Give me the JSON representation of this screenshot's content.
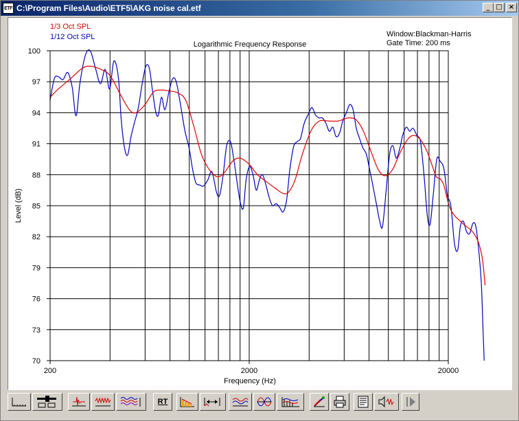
{
  "window": {
    "title": "C:\\Program Files\\Audio\\ETF5\\AKG noise cal.etf",
    "icon_text": "ETF",
    "controls": {
      "minimize": "_",
      "maximize": "□",
      "close": "×"
    }
  },
  "plot": {
    "header_left": [
      "1/3 Oct SPL",
      "1/12 Oct SPL"
    ],
    "header_right": [
      "Window:Blackman-Harris",
      "Gate Time: 200 ms"
    ]
  },
  "chart_data": {
    "type": "line",
    "title": "Logarithmic Frequency Response",
    "xlabel": "Frequency (Hz)",
    "ylabel": "Level (dB)",
    "xscale": "log",
    "xlim": [
      200,
      20000
    ],
    "ylim": [
      70,
      100
    ],
    "xticks": [
      200,
      2000,
      20000
    ],
    "yticks": [
      70,
      73,
      76,
      79,
      82,
      85,
      88,
      91,
      94,
      97,
      100
    ],
    "grid": true,
    "legend": "top-left",
    "series": [
      {
        "name": "1/3 Oct SPL",
        "color": "#e00000",
        "points": [
          [
            200,
            95.5
          ],
          [
            220,
            96.3
          ],
          [
            250,
            97.2
          ],
          [
            290,
            98.3
          ],
          [
            320,
            98.5
          ],
          [
            360,
            98.2
          ],
          [
            400,
            97.6
          ],
          [
            450,
            95.8
          ],
          [
            500,
            94.3
          ],
          [
            540,
            94.0
          ],
          [
            600,
            94.8
          ],
          [
            660,
            96.0
          ],
          [
            720,
            96.2
          ],
          [
            800,
            96.1
          ],
          [
            880,
            95.9
          ],
          [
            960,
            95.2
          ],
          [
            1050,
            92.8
          ],
          [
            1150,
            90.0
          ],
          [
            1250,
            88.6
          ],
          [
            1380,
            87.8
          ],
          [
            1500,
            88.2
          ],
          [
            1650,
            89.3
          ],
          [
            1800,
            89.6
          ],
          [
            2000,
            89.0
          ],
          [
            2200,
            88.0
          ],
          [
            2450,
            87.3
          ],
          [
            2700,
            86.7
          ],
          [
            2950,
            86.2
          ],
          [
            3150,
            86.3
          ],
          [
            3400,
            87.5
          ],
          [
            3700,
            90.0
          ],
          [
            4100,
            92.3
          ],
          [
            4500,
            93.2
          ],
          [
            5000,
            93.2
          ],
          [
            5600,
            93.2
          ],
          [
            6300,
            93.5
          ],
          [
            6900,
            93.3
          ],
          [
            7500,
            92.2
          ],
          [
            8200,
            90.2
          ],
          [
            8900,
            88.5
          ],
          [
            9600,
            87.9
          ],
          [
            10500,
            88.5
          ],
          [
            11500,
            90.2
          ],
          [
            12600,
            91.5
          ],
          [
            13500,
            91.8
          ],
          [
            14500,
            91.4
          ],
          [
            15600,
            90.3
          ],
          [
            16600,
            88.9
          ],
          [
            17400,
            87.8
          ],
          [
            18200,
            87.6
          ],
          [
            19000,
            87.0
          ],
          [
            19800,
            85.6
          ],
          [
            20600,
            84.6
          ],
          [
            21600,
            84.0
          ],
          [
            22700,
            83.6
          ],
          [
            23900,
            83.2
          ],
          [
            25400,
            82.8
          ],
          [
            26900,
            82.3
          ],
          [
            28400,
            81.4
          ],
          [
            29700,
            79.8
          ],
          [
            30600,
            77.3
          ]
        ]
      },
      {
        "name": "1/12 Oct SPL",
        "color": "#0000c0",
        "points": [
          [
            200,
            95.2
          ],
          [
            210,
            97.3
          ],
          [
            220,
            97.5
          ],
          [
            232,
            97.2
          ],
          [
            245,
            97.9
          ],
          [
            258,
            96.5
          ],
          [
            270,
            93.7
          ],
          [
            282,
            96.8
          ],
          [
            300,
            99.5
          ],
          [
            318,
            100.0
          ],
          [
            338,
            98.3
          ],
          [
            358,
            96.8
          ],
          [
            378,
            98.2
          ],
          [
            398,
            96.3
          ],
          [
            418,
            99.0
          ],
          [
            440,
            97.5
          ],
          [
            455,
            93.4
          ],
          [
            472,
            90.7
          ],
          [
            490,
            89.9
          ],
          [
            510,
            91.7
          ],
          [
            530,
            93.0
          ],
          [
            555,
            94.5
          ],
          [
            580,
            96.8
          ],
          [
            605,
            98.5
          ],
          [
            630,
            98.3
          ],
          [
            655,
            96.0
          ],
          [
            680,
            94.0
          ],
          [
            700,
            93.8
          ],
          [
            725,
            95.5
          ],
          [
            755,
            94.3
          ],
          [
            790,
            96.0
          ],
          [
            825,
            97.3
          ],
          [
            860,
            97.0
          ],
          [
            900,
            95.0
          ],
          [
            950,
            92.3
          ],
          [
            1000,
            90.5
          ],
          [
            1040,
            88.5
          ],
          [
            1080,
            87.2
          ],
          [
            1130,
            87.0
          ],
          [
            1180,
            86.9
          ],
          [
            1240,
            87.5
          ],
          [
            1300,
            88.3
          ],
          [
            1370,
            86.3
          ],
          [
            1420,
            86.0
          ],
          [
            1480,
            88.0
          ],
          [
            1540,
            90.8
          ],
          [
            1610,
            91.2
          ],
          [
            1680,
            89.3
          ],
          [
            1740,
            87.2
          ],
          [
            1810,
            85.2
          ],
          [
            1870,
            84.8
          ],
          [
            1930,
            87.5
          ],
          [
            2010,
            88.8
          ],
          [
            2090,
            88.0
          ],
          [
            2170,
            86.5
          ],
          [
            2250,
            87.5
          ],
          [
            2330,
            88.0
          ],
          [
            2420,
            87.1
          ],
          [
            2520,
            85.8
          ],
          [
            2620,
            85.0
          ],
          [
            2730,
            85.2
          ],
          [
            2850,
            84.8
          ],
          [
            2960,
            84.4
          ],
          [
            3080,
            85.5
          ],
          [
            3200,
            88.5
          ],
          [
            3340,
            90.7
          ],
          [
            3480,
            91.2
          ],
          [
            3620,
            91.5
          ],
          [
            3780,
            93.0
          ],
          [
            3950,
            93.8
          ],
          [
            4130,
            94.5
          ],
          [
            4300,
            93.8
          ],
          [
            4480,
            93.5
          ],
          [
            4660,
            93.5
          ],
          [
            4850,
            93.0
          ],
          [
            5050,
            92.2
          ],
          [
            5260,
            92.6
          ],
          [
            5460,
            91.7
          ],
          [
            5680,
            92.0
          ],
          [
            5900,
            93.2
          ],
          [
            6150,
            94.0
          ],
          [
            6400,
            94.8
          ],
          [
            6650,
            94.3
          ],
          [
            6900,
            92.5
          ],
          [
            7170,
            91.5
          ],
          [
            7450,
            90.6
          ],
          [
            7750,
            90.0
          ],
          [
            8050,
            88.5
          ],
          [
            8350,
            87.0
          ],
          [
            8700,
            85.2
          ],
          [
            9050,
            83.5
          ],
          [
            9350,
            83.0
          ],
          [
            9750,
            86.5
          ],
          [
            10150,
            90.0
          ],
          [
            10550,
            90.8
          ],
          [
            10950,
            89.6
          ],
          [
            11400,
            90.5
          ],
          [
            11800,
            91.8
          ],
          [
            12300,
            92.6
          ],
          [
            12800,
            92.2
          ],
          [
            13300,
            92.5
          ],
          [
            13900,
            91.8
          ],
          [
            14500,
            91.2
          ],
          [
            15100,
            88.0
          ],
          [
            15700,
            84.0
          ],
          [
            16200,
            83.2
          ],
          [
            16800,
            86.0
          ],
          [
            17500,
            89.5
          ],
          [
            18200,
            89.3
          ],
          [
            19000,
            88.6
          ],
          [
            19800,
            86.0
          ],
          [
            20600,
            85.0
          ],
          [
            21500,
            81.3
          ],
          [
            22300,
            80.7
          ],
          [
            23000,
            83.0
          ],
          [
            23800,
            83.5
          ],
          [
            24700,
            82.5
          ],
          [
            25600,
            82.3
          ],
          [
            26600,
            83.3
          ],
          [
            27500,
            83.0
          ],
          [
            28400,
            80.8
          ],
          [
            29300,
            77.5
          ],
          [
            29900,
            73.0
          ],
          [
            30300,
            70.0
          ]
        ]
      }
    ]
  },
  "toolbar": {
    "buttons": [
      {
        "id": "impulse-axis",
        "label": ""
      },
      {
        "id": "slider-settings",
        "label": ""
      },
      {
        "id": "impulse",
        "label": ""
      },
      {
        "id": "energy",
        "label": ""
      },
      {
        "id": "waterfall",
        "label": ""
      },
      {
        "id": "rt60",
        "label": "RT"
      },
      {
        "id": "histogram",
        "label": ""
      },
      {
        "id": "gate",
        "label": ""
      },
      {
        "id": "freq-response",
        "label": ""
      },
      {
        "id": "phase",
        "label": ""
      },
      {
        "id": "spectrogram",
        "label": ""
      },
      {
        "id": "color-tool",
        "label": ""
      },
      {
        "id": "print",
        "label": ""
      },
      {
        "id": "notes",
        "label": ""
      },
      {
        "id": "speaker-play",
        "label": ""
      },
      {
        "id": "run",
        "label": ""
      }
    ]
  }
}
